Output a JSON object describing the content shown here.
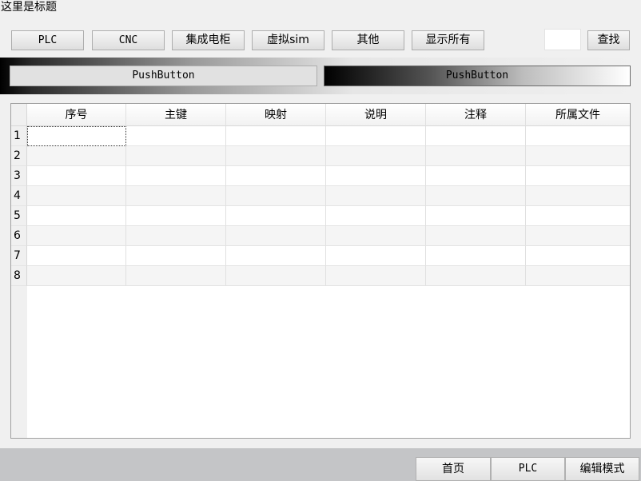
{
  "window": {
    "title": "这里是标题"
  },
  "toolbar": {
    "buttons": [
      {
        "label": "PLC"
      },
      {
        "label": "CNC"
      },
      {
        "label": "集成电柜"
      },
      {
        "label": "虚拟sim"
      },
      {
        "label": "其他"
      },
      {
        "label": "显示所有"
      }
    ],
    "search_value": "",
    "search_label": "查找"
  },
  "push_buttons": [
    {
      "label": "PushButton"
    },
    {
      "label": "PushButton"
    }
  ],
  "table": {
    "columns": [
      "序号",
      "主键",
      "映射",
      "说明",
      "注释",
      "所属文件"
    ],
    "row_numbers": [
      "1",
      "2",
      "3",
      "4",
      "5",
      "6",
      "7",
      "8"
    ]
  },
  "bottom_nav": [
    {
      "label": "首页"
    },
    {
      "label": "PLC"
    },
    {
      "label": "编辑模式"
    }
  ]
}
